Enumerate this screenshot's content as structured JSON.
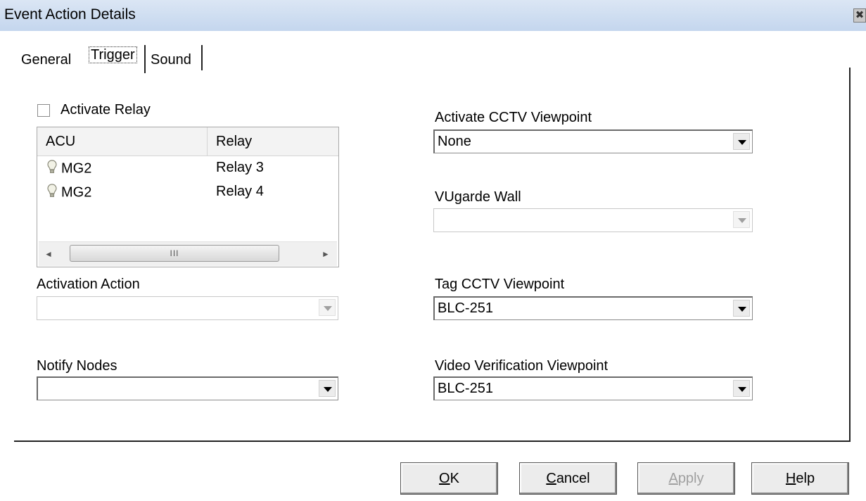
{
  "window": {
    "title": "Event Action Details",
    "close_glyph": "✖"
  },
  "tabs": [
    {
      "label": "General"
    },
    {
      "label": "Trigger",
      "selected": true
    },
    {
      "label": "Sound"
    }
  ],
  "relay": {
    "checkbox_label": "Activate Relay",
    "checked": false,
    "columns": [
      "ACU",
      "Relay"
    ],
    "rows": [
      {
        "acu": "MG2",
        "relay": "Relay 3",
        "icon": "lightbulb-icon"
      },
      {
        "acu": "MG2",
        "relay": "Relay 4",
        "icon": "lightbulb-icon"
      }
    ],
    "scroll_thumb_glyph": "III",
    "scroll_left_glyph": "◄",
    "scroll_right_glyph": "►"
  },
  "activation_action": {
    "label": "Activation Action",
    "value": ""
  },
  "notify_nodes": {
    "label": "Notify Nodes",
    "value": ""
  },
  "cctv_viewpoint": {
    "label": "Activate CCTV Viewpoint",
    "value": "None"
  },
  "vugarde_wall": {
    "label": "VUgarde Wall",
    "value": ""
  },
  "tag_cctv": {
    "label": "Tag CCTV Viewpoint",
    "value": "BLC-251"
  },
  "video_verification": {
    "label": "Video Verification Viewpoint",
    "value": "BLC-251"
  },
  "buttons": {
    "ok": {
      "mnemonic": "O",
      "rest": "K"
    },
    "cancel": {
      "mnemonic": "C",
      "rest": "ancel"
    },
    "apply": {
      "mnemonic": "A",
      "rest": "pply"
    },
    "help": {
      "mnemonic": "H",
      "rest": "elp"
    }
  }
}
